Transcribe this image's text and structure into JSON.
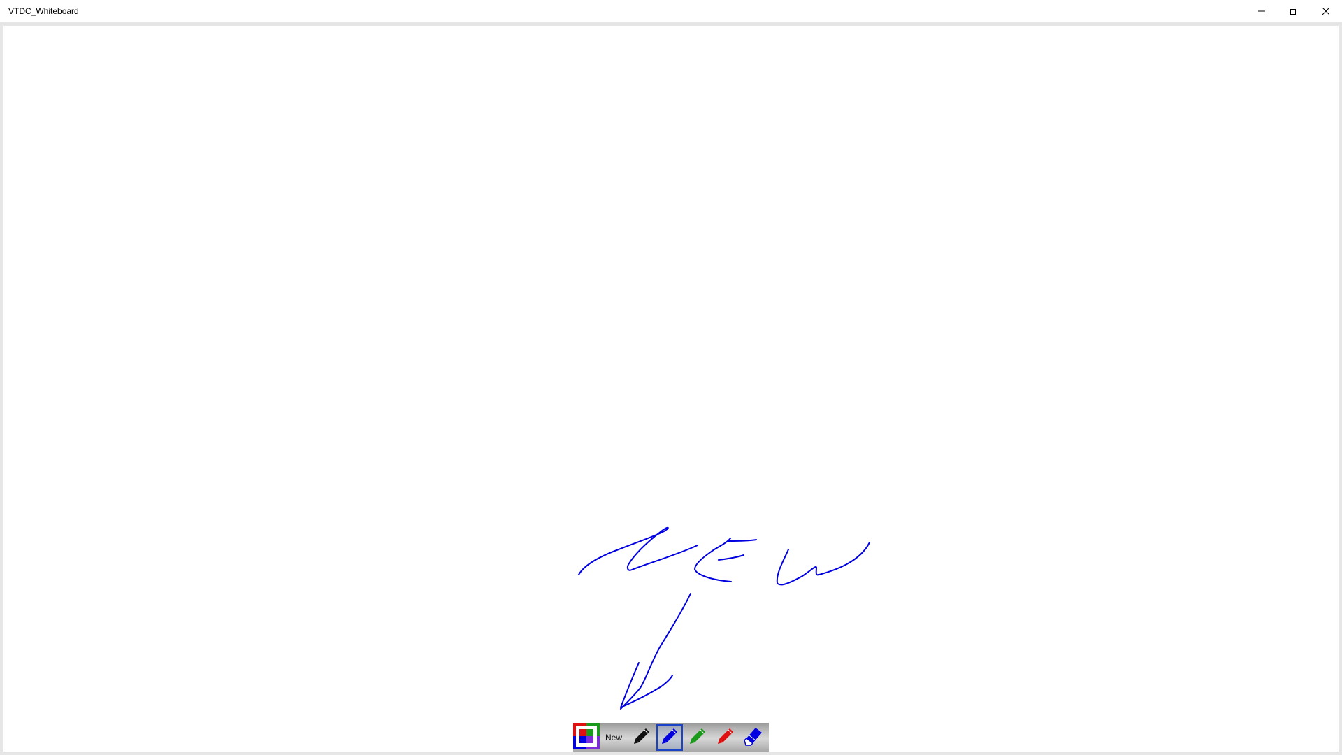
{
  "window": {
    "title": "VTDC_Whiteboard",
    "controls": {
      "minimize_icon": "minimize-icon",
      "restore_icon": "restore-icon",
      "close_icon": "close-icon"
    }
  },
  "canvas": {
    "background": "#ffffff",
    "ink_color": "#0000e0",
    "ink_strokes_depict": "handwritten word and arrow pointing to the New button"
  },
  "toolbar": {
    "new_label": "New",
    "selected_tool": "blue-pen",
    "tools": [
      {
        "name": "color-picker",
        "icon": "color-picker-icon"
      },
      {
        "name": "new",
        "label": "New"
      },
      {
        "name": "black-pen",
        "icon": "pen-icon",
        "color": "#111111"
      },
      {
        "name": "blue-pen",
        "icon": "pen-icon",
        "color": "#0000e0"
      },
      {
        "name": "green-pen",
        "icon": "pen-icon",
        "color": "#1a9a1a"
      },
      {
        "name": "red-pen",
        "icon": "pen-icon",
        "color": "#e01010"
      },
      {
        "name": "eraser",
        "icon": "eraser-icon",
        "color": "#0000e0"
      }
    ]
  }
}
